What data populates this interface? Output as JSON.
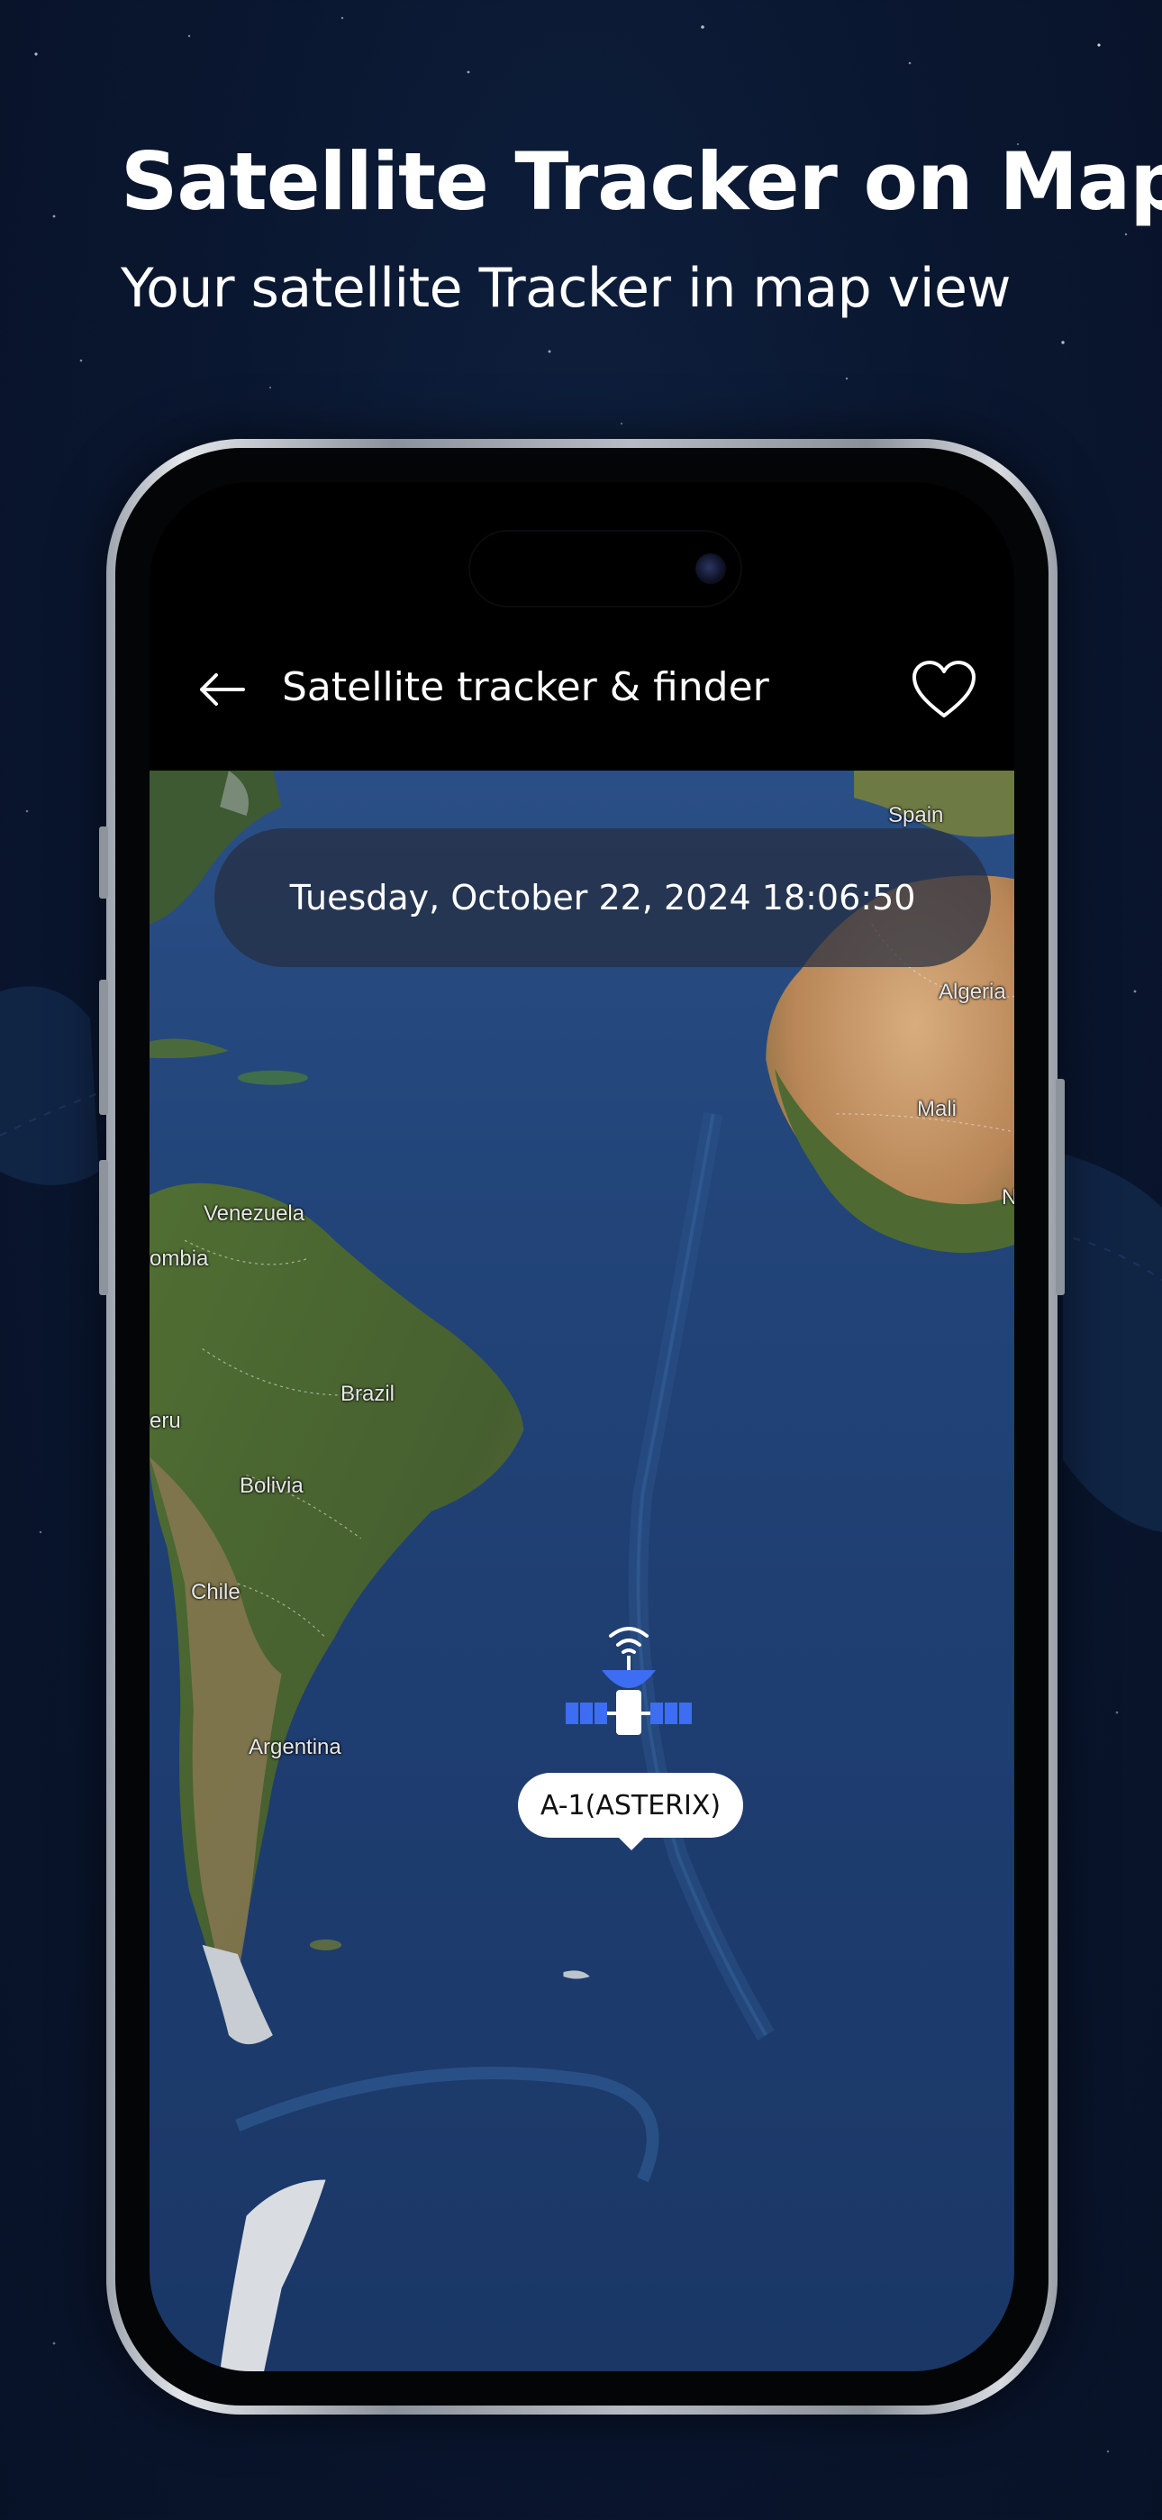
{
  "promo": {
    "title": "Satellite Tracker on Map",
    "subtitle": "Your satellite Tracker in map view"
  },
  "app_bar": {
    "title": "Satellite tracker & finder",
    "back_icon": "arrow-left-icon",
    "favorite_icon": "heart-outline-icon"
  },
  "map": {
    "datetime": "Tuesday, October 22, 2024 18:06:50",
    "labels": {
      "spain": "Spain",
      "algeria": "Algeria",
      "mali": "Mali",
      "niger": "Nig",
      "venezuela": "Venezuela",
      "colombia": "ombia",
      "peru": "eru",
      "brazil": "Brazil",
      "bolivia": "Bolivia",
      "chile": "Chile",
      "argentina": "Argentina"
    },
    "satellite": {
      "name": "A-1(ASTERIX)",
      "icon": "satellite-icon"
    }
  },
  "colors": {
    "background": "#0a1730",
    "ocean": "#22457a",
    "land_green": "#4d6a34",
    "land_desert": "#c79a6a",
    "satellite_blue": "#3d6df2"
  }
}
